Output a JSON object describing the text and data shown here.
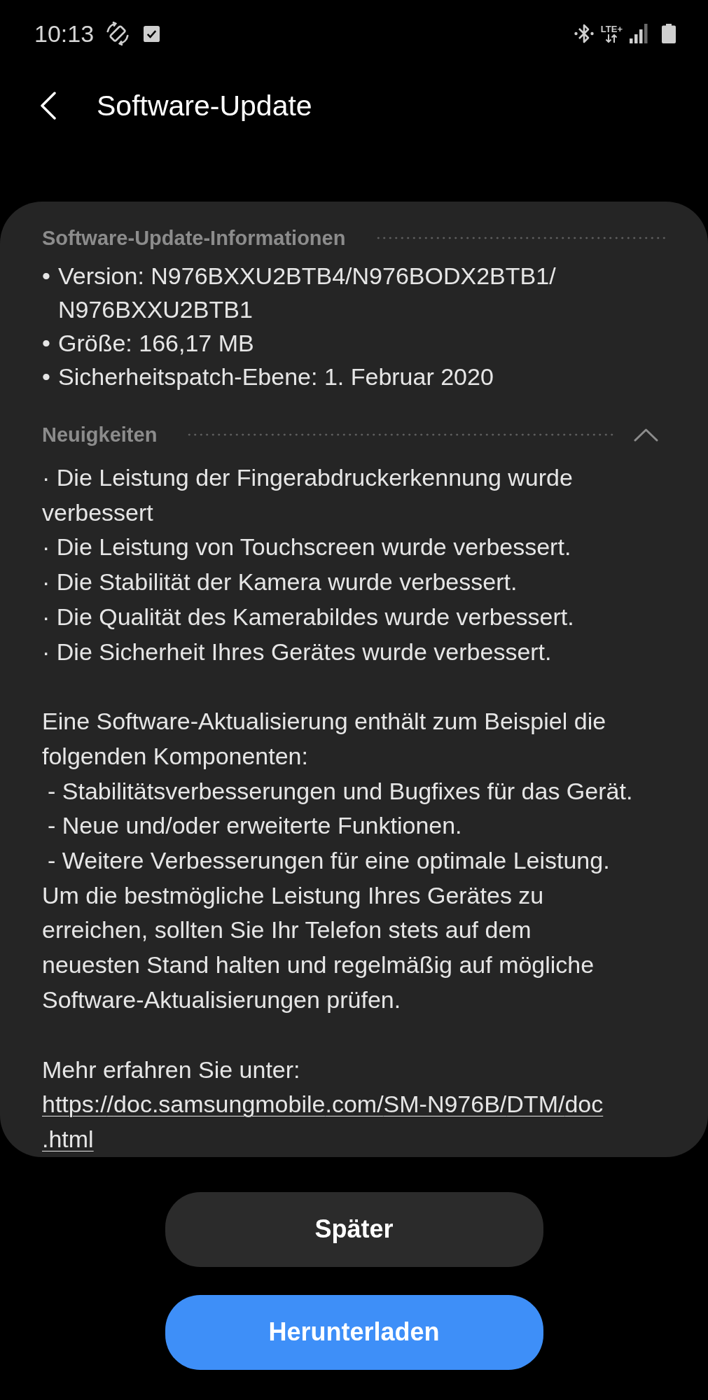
{
  "status_bar": {
    "time": "10:13",
    "network": "LTE+"
  },
  "header": {
    "title": "Software-Update"
  },
  "info": {
    "title": "Software-Update-Informationen",
    "items": [
      {
        "marker": "•",
        "text": "Version: N976BXXU2BTB4/N976BODX2BTB1/N976BXXU2BTB1"
      },
      {
        "marker": "•",
        "text": "Größe: 166,17 MB"
      },
      {
        "marker": "•",
        "text": "Sicherheitspatch-Ebene: 1. Februar 2020"
      }
    ]
  },
  "whats_new": {
    "title": "Neuigkeiten",
    "expanded": true,
    "changes": [
      "· Die Leistung der Fingerabdruckerkennung wurde verbessert",
      "· Die Leistung von Touchscreen wurde verbessert.",
      "· Die Stabilität der Kamera wurde verbessert.",
      "· Die Qualität des Kamerabildes wurde verbessert.",
      "· Die Sicherheit Ihres Gerätes wurde verbessert."
    ],
    "description": [
      {
        "kind": "paragraph",
        "text": "Eine Software-Aktualisierung enthält zum Beispiel die folgenden Komponenten:"
      },
      {
        "kind": "sub_item",
        "text": "- Stabilitätsverbesserungen und Bugfixes für das Gerät."
      },
      {
        "kind": "sub_item",
        "text": "- Neue und/oder erweiterte Funktionen."
      },
      {
        "kind": "sub_item",
        "text": "- Weitere Verbesserungen für eine optimale Leistung."
      },
      {
        "kind": "paragraph",
        "text": "Um die bestmögliche Leistung Ihres Gerätes zu erreichen, sollten Sie Ihr Telefon stets auf dem neuesten Stand halten und regelmäßig auf mögliche Software-Aktualisierungen prüfen."
      }
    ],
    "more_info": {
      "label": "Mehr erfahren Sie unter:",
      "url": "https://doc.samsungmobile.com/SM-N976B/DTM/doc.html"
    }
  },
  "buttons": [
    {
      "kind": "secondary",
      "label": "Später"
    },
    {
      "kind": "primary",
      "label": "Herunterladen"
    }
  ]
}
